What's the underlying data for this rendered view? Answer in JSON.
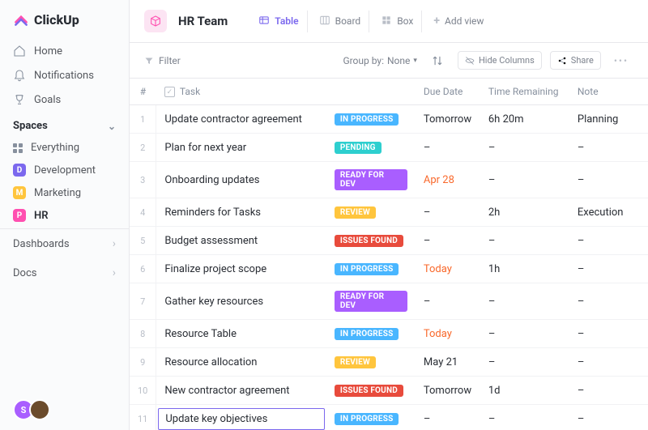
{
  "brand": "ClickUp",
  "sidebar": {
    "nav": [
      {
        "label": "Home",
        "icon": "home-icon"
      },
      {
        "label": "Notifications",
        "icon": "bell-icon"
      },
      {
        "label": "Goals",
        "icon": "trophy-icon"
      }
    ],
    "spaces_header": "Spaces",
    "spaces": [
      {
        "label": "Everything",
        "icon": "grid",
        "color": ""
      },
      {
        "label": "Development",
        "badge": "D",
        "color": "#7b68ee"
      },
      {
        "label": "Marketing",
        "badge": "M",
        "color": "#ffc53d"
      },
      {
        "label": "HR",
        "badge": "P",
        "color": "#ff4fb0",
        "active": true
      }
    ],
    "bottom": [
      {
        "label": "Dashboards"
      },
      {
        "label": "Docs"
      }
    ]
  },
  "header": {
    "space_title": "HR Team",
    "views": [
      {
        "label": "Table",
        "active": true
      },
      {
        "label": "Board"
      },
      {
        "label": "Box"
      },
      {
        "label": "Add view",
        "add": true
      }
    ]
  },
  "toolbar": {
    "filter": "Filter",
    "groupby_label": "Group by:",
    "groupby_value": "None",
    "hide_columns": "Hide Columns",
    "share": "Share"
  },
  "columns": {
    "num": "#",
    "task": "Task",
    "due": "Due Date",
    "time": "Time Remaining",
    "note": "Note"
  },
  "status_colors": {
    "IN PROGRESS": "#49b6ff",
    "PENDING": "#2ecfcf",
    "READY FOR DEV": "#a95eff",
    "REVIEW": "#ffc53d",
    "ISSUES FOUND": "#e84b3c"
  },
  "rows": [
    {
      "n": "1",
      "task": "Update contractor agreement",
      "status": "IN PROGRESS",
      "due": "Tomorrow",
      "time": "6h 20m",
      "note": "Planning"
    },
    {
      "n": "2",
      "task": "Plan for next year",
      "status": "PENDING",
      "due": "–",
      "time": "–",
      "note": "–"
    },
    {
      "n": "3",
      "task": "Onboarding updates",
      "status": "READY FOR DEV",
      "due": "Apr 28",
      "due_orange": true,
      "time": "–",
      "note": "–"
    },
    {
      "n": "4",
      "task": "Reminders for Tasks",
      "status": "REVIEW",
      "due": "–",
      "time": "2h",
      "note": "Execution"
    },
    {
      "n": "5",
      "task": "Budget assessment",
      "status": "ISSUES FOUND",
      "due": "–",
      "time": "–",
      "note": "–"
    },
    {
      "n": "6",
      "task": "Finalize project scope",
      "status": "IN PROGRESS",
      "due": "Today",
      "due_orange": true,
      "time": "1h",
      "note": "–"
    },
    {
      "n": "7",
      "task": "Gather key resources",
      "status": "READY FOR DEV",
      "due": "–",
      "time": "–",
      "note": "–"
    },
    {
      "n": "8",
      "task": "Resource Table",
      "status": "IN PROGRESS",
      "due": "Today",
      "due_orange": true,
      "time": "–",
      "note": "–"
    },
    {
      "n": "9",
      "task": "Resource allocation",
      "status": "REVIEW",
      "due": "May 21",
      "time": "–",
      "note": "–"
    },
    {
      "n": "10",
      "task": "New contractor agreement",
      "status": "ISSUES FOUND",
      "due": "Tomorrow",
      "time": "1d",
      "note": "–"
    },
    {
      "n": "11",
      "task": "Update key objectives",
      "status": "IN PROGRESS",
      "due": "–",
      "time": "–",
      "note": "–",
      "editing": true
    }
  ],
  "avatars": [
    {
      "bg": "#a95eff",
      "label": "S"
    },
    {
      "bg": "#6b4b2b",
      "label": ""
    }
  ]
}
